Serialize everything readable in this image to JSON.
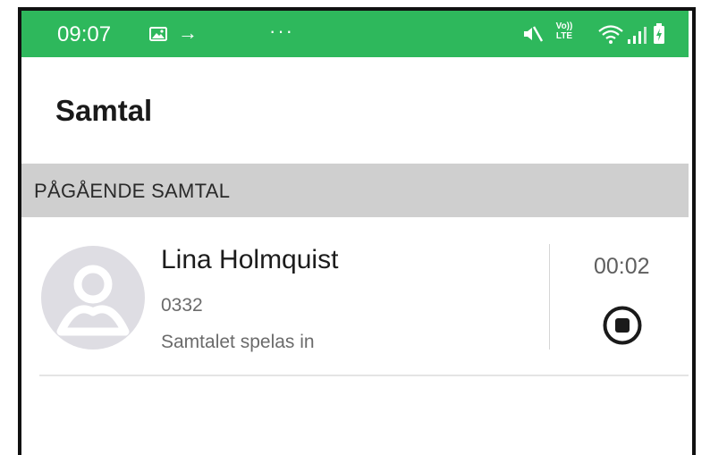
{
  "status_bar": {
    "time": "09:07",
    "arrow": "→",
    "dots": "···",
    "icons": [
      "image-icon",
      "mute-icon",
      "volte-icon",
      "wifi-icon",
      "signal-icon",
      "battery-icon"
    ],
    "volte_top": "Vo))",
    "volte_bottom": "LTE",
    "color": "#2eb85c"
  },
  "app_bar": {
    "title": "Samtal"
  },
  "section": {
    "label": "PÅGÅENDE SAMTAL"
  },
  "call": {
    "name": "Lina Holmquist",
    "number": "0332",
    "status": "Samtalet spelas in",
    "duration": "00:02",
    "stop_icon": "stop-record-icon"
  }
}
